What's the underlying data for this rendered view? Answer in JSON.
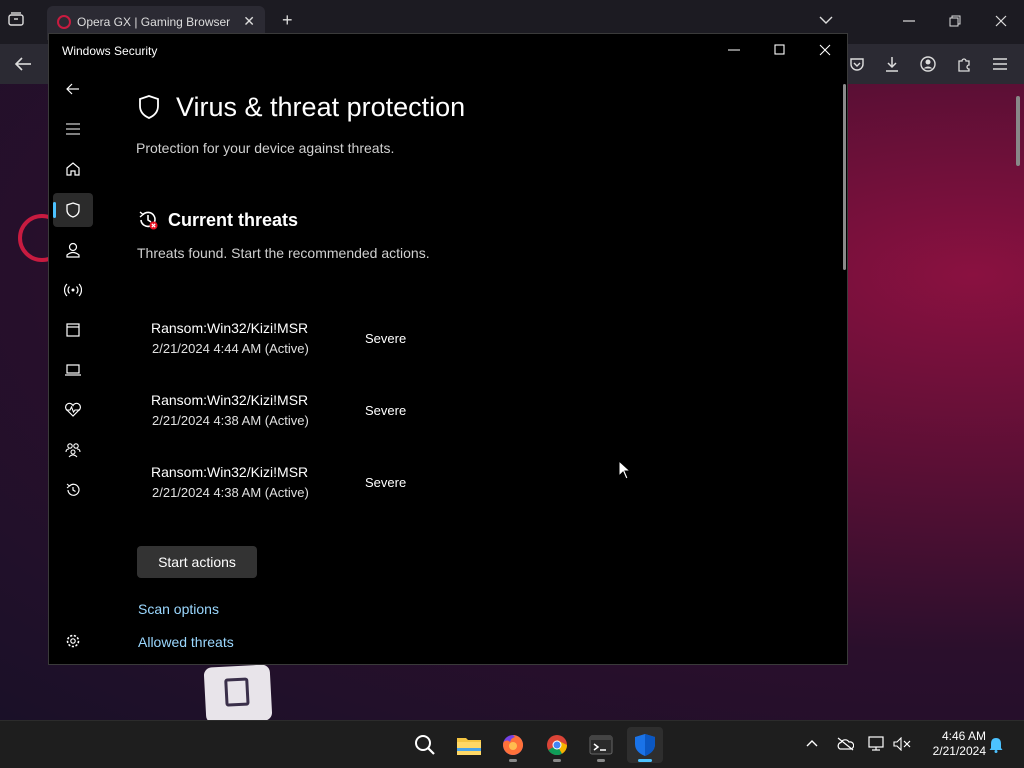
{
  "browser": {
    "tab_title": "Opera GX | Gaming Browser",
    "tab_close": "✕",
    "new_tab": "+"
  },
  "window": {
    "title": "Windows Security",
    "minimize": "—",
    "maximize": "☐",
    "close": "✕"
  },
  "page": {
    "title": "Virus & threat protection",
    "subtitle": "Protection for your device against threats."
  },
  "current_threats": {
    "title": "Current threats",
    "description": "Threats found. Start the recommended actions.",
    "items": [
      {
        "name": "Ransom:Win32/Kizi!MSR",
        "date": "2/21/2024 4:44 AM (Active)",
        "severity": "Severe"
      },
      {
        "name": "Ransom:Win32/Kizi!MSR",
        "date": "2/21/2024 4:38 AM (Active)",
        "severity": "Severe"
      },
      {
        "name": "Ransom:Win32/Kizi!MSR",
        "date": "2/21/2024 4:38 AM (Active)",
        "severity": "Severe"
      }
    ],
    "start_actions_label": "Start actions"
  },
  "links": {
    "scan_options": "Scan options",
    "allowed_threats": "Allowed threats"
  },
  "nav": {
    "items": [
      "back-icon",
      "menu-icon",
      "home-icon",
      "shield-icon",
      "account-icon",
      "network-icon",
      "app-browser-icon",
      "device-security-icon",
      "health-icon",
      "family-icon",
      "history-icon",
      "settings-icon"
    ],
    "selected": "shield-icon"
  },
  "taskbar": {
    "apps": [
      "search-icon",
      "file-explorer-icon",
      "firefox-icon",
      "chrome-icon",
      "terminal-icon",
      "windows-security-icon"
    ],
    "active_app": "windows-security-icon",
    "time": "4:46 AM",
    "date": "2/21/2024"
  },
  "colors": {
    "accent": "#4cc2ff",
    "link": "#9bd8ff",
    "window_bg": "#000000",
    "opera_red": "#c81b40"
  }
}
